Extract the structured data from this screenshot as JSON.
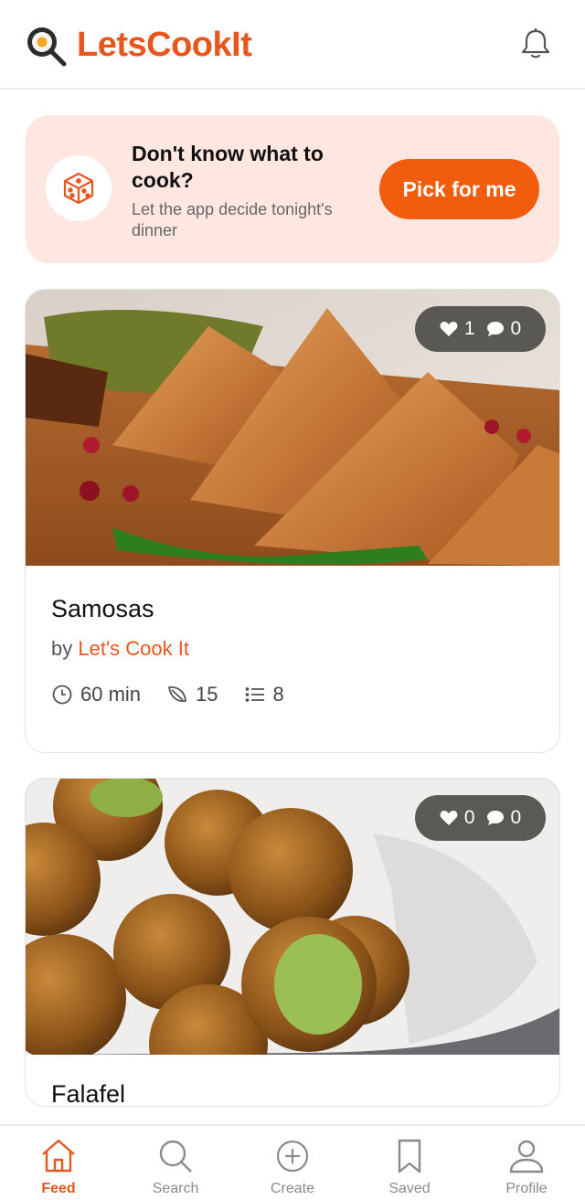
{
  "app": {
    "brand": "LetsCookIt",
    "accent_color": "#e8561e",
    "icons": {
      "logo": "frying-pan-search-icon",
      "notifications": "bell-icon"
    }
  },
  "banner": {
    "icon": "dice-icon",
    "title": "Don't know what to cook?",
    "subtitle": "Let the app decide tonight's dinner",
    "button_label": "Pick for me"
  },
  "feed": {
    "cards": [
      {
        "title": "Samosas",
        "by_label": "by",
        "author": "Let's Cook It",
        "likes": "1",
        "comments": "0",
        "time": "60 min",
        "leaf_count": "15",
        "list_count": "8"
      },
      {
        "title": "Falafel",
        "likes": "0",
        "comments": "0"
      }
    ]
  },
  "nav": {
    "items": [
      {
        "label": "Feed",
        "icon": "home-icon",
        "active": true
      },
      {
        "label": "Search",
        "icon": "search-icon",
        "active": false
      },
      {
        "label": "Create",
        "icon": "plus-circle-icon",
        "active": false
      },
      {
        "label": "Saved",
        "icon": "bookmark-icon",
        "active": false
      },
      {
        "label": "Profile",
        "icon": "user-icon",
        "active": false
      }
    ]
  }
}
